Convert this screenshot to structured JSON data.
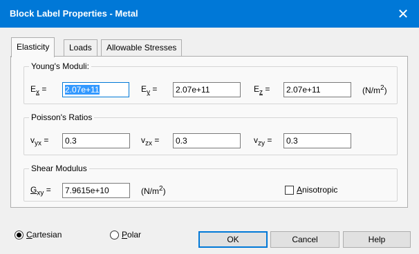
{
  "window": {
    "title": "Block Label Properties - Metal",
    "close_glyph": "✕"
  },
  "tabs": [
    "Elasticity",
    "Loads",
    "Allowable Stresses"
  ],
  "youngs": {
    "legend": "Young's Moduli:",
    "ex_label": "E",
    "ex_sub": "x",
    "ex_value": "2.07e+11",
    "ey_label": "E",
    "ey_sub": "y",
    "ey_value": "2.07e+11",
    "ez_label": "E",
    "ez_sub": "z",
    "ez_value": "2.07e+11",
    "eq": "=",
    "units_pre": "(N/m",
    "units_exp": "2",
    "units_post": ")"
  },
  "poisson": {
    "legend": "Poisson's Ratios",
    "vyx_label": "v",
    "vyx_sub": "yx",
    "vyx_value": "0.3",
    "vzx_label": "v",
    "vzx_sub": "zx",
    "vzx_value": "0.3",
    "vzy_label": "v",
    "vzy_sub": "zy",
    "vzy_value": "0.3",
    "eq": "="
  },
  "shear": {
    "legend": "Shear Modulus",
    "g_label": "G",
    "g_sub": "xy",
    "g_value": "7.9615e+10",
    "eq": "=",
    "units_pre": "(N/m",
    "units_exp": "2",
    "units_post": ")",
    "aniso_first": "A",
    "aniso_rest": "nisotropic",
    "aniso_checked": false
  },
  "coords": {
    "cartesian_first": "C",
    "cartesian_rest": "artesian",
    "cartesian_selected": true,
    "polar_first": "P",
    "polar_rest": "olar",
    "polar_selected": false
  },
  "buttons": {
    "ok": "OK",
    "cancel": "Cancel",
    "help": "Help"
  }
}
